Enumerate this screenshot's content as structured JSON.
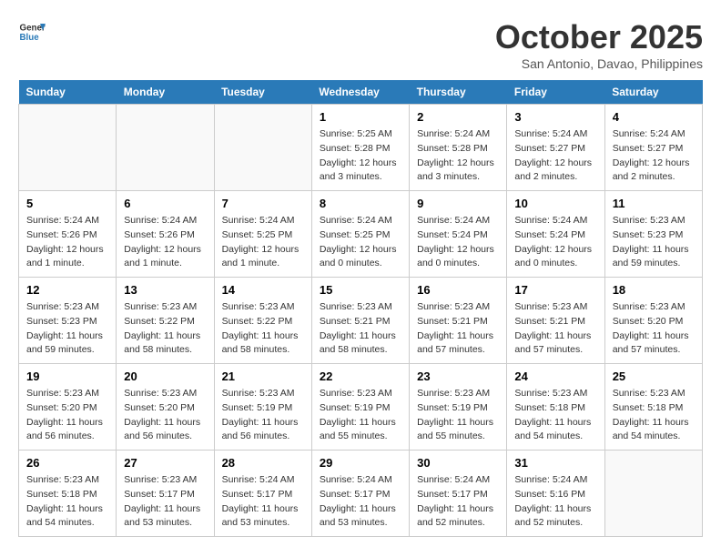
{
  "logo": {
    "line1": "General",
    "line2": "Blue"
  },
  "title": "October 2025",
  "subtitle": "San Antonio, Davao, Philippines",
  "days_of_week": [
    "Sunday",
    "Monday",
    "Tuesday",
    "Wednesday",
    "Thursday",
    "Friday",
    "Saturday"
  ],
  "weeks": [
    [
      {
        "day": "",
        "info": ""
      },
      {
        "day": "",
        "info": ""
      },
      {
        "day": "",
        "info": ""
      },
      {
        "day": "1",
        "info": "Sunrise: 5:25 AM\nSunset: 5:28 PM\nDaylight: 12 hours and 3 minutes."
      },
      {
        "day": "2",
        "info": "Sunrise: 5:24 AM\nSunset: 5:28 PM\nDaylight: 12 hours and 3 minutes."
      },
      {
        "day": "3",
        "info": "Sunrise: 5:24 AM\nSunset: 5:27 PM\nDaylight: 12 hours and 2 minutes."
      },
      {
        "day": "4",
        "info": "Sunrise: 5:24 AM\nSunset: 5:27 PM\nDaylight: 12 hours and 2 minutes."
      }
    ],
    [
      {
        "day": "5",
        "info": "Sunrise: 5:24 AM\nSunset: 5:26 PM\nDaylight: 12 hours and 1 minute."
      },
      {
        "day": "6",
        "info": "Sunrise: 5:24 AM\nSunset: 5:26 PM\nDaylight: 12 hours and 1 minute."
      },
      {
        "day": "7",
        "info": "Sunrise: 5:24 AM\nSunset: 5:25 PM\nDaylight: 12 hours and 1 minute."
      },
      {
        "day": "8",
        "info": "Sunrise: 5:24 AM\nSunset: 5:25 PM\nDaylight: 12 hours and 0 minutes."
      },
      {
        "day": "9",
        "info": "Sunrise: 5:24 AM\nSunset: 5:24 PM\nDaylight: 12 hours and 0 minutes."
      },
      {
        "day": "10",
        "info": "Sunrise: 5:24 AM\nSunset: 5:24 PM\nDaylight: 12 hours and 0 minutes."
      },
      {
        "day": "11",
        "info": "Sunrise: 5:23 AM\nSunset: 5:23 PM\nDaylight: 11 hours and 59 minutes."
      }
    ],
    [
      {
        "day": "12",
        "info": "Sunrise: 5:23 AM\nSunset: 5:23 PM\nDaylight: 11 hours and 59 minutes."
      },
      {
        "day": "13",
        "info": "Sunrise: 5:23 AM\nSunset: 5:22 PM\nDaylight: 11 hours and 58 minutes."
      },
      {
        "day": "14",
        "info": "Sunrise: 5:23 AM\nSunset: 5:22 PM\nDaylight: 11 hours and 58 minutes."
      },
      {
        "day": "15",
        "info": "Sunrise: 5:23 AM\nSunset: 5:21 PM\nDaylight: 11 hours and 58 minutes."
      },
      {
        "day": "16",
        "info": "Sunrise: 5:23 AM\nSunset: 5:21 PM\nDaylight: 11 hours and 57 minutes."
      },
      {
        "day": "17",
        "info": "Sunrise: 5:23 AM\nSunset: 5:21 PM\nDaylight: 11 hours and 57 minutes."
      },
      {
        "day": "18",
        "info": "Sunrise: 5:23 AM\nSunset: 5:20 PM\nDaylight: 11 hours and 57 minutes."
      }
    ],
    [
      {
        "day": "19",
        "info": "Sunrise: 5:23 AM\nSunset: 5:20 PM\nDaylight: 11 hours and 56 minutes."
      },
      {
        "day": "20",
        "info": "Sunrise: 5:23 AM\nSunset: 5:20 PM\nDaylight: 11 hours and 56 minutes."
      },
      {
        "day": "21",
        "info": "Sunrise: 5:23 AM\nSunset: 5:19 PM\nDaylight: 11 hours and 56 minutes."
      },
      {
        "day": "22",
        "info": "Sunrise: 5:23 AM\nSunset: 5:19 PM\nDaylight: 11 hours and 55 minutes."
      },
      {
        "day": "23",
        "info": "Sunrise: 5:23 AM\nSunset: 5:19 PM\nDaylight: 11 hours and 55 minutes."
      },
      {
        "day": "24",
        "info": "Sunrise: 5:23 AM\nSunset: 5:18 PM\nDaylight: 11 hours and 54 minutes."
      },
      {
        "day": "25",
        "info": "Sunrise: 5:23 AM\nSunset: 5:18 PM\nDaylight: 11 hours and 54 minutes."
      }
    ],
    [
      {
        "day": "26",
        "info": "Sunrise: 5:23 AM\nSunset: 5:18 PM\nDaylight: 11 hours and 54 minutes."
      },
      {
        "day": "27",
        "info": "Sunrise: 5:23 AM\nSunset: 5:17 PM\nDaylight: 11 hours and 53 minutes."
      },
      {
        "day": "28",
        "info": "Sunrise: 5:24 AM\nSunset: 5:17 PM\nDaylight: 11 hours and 53 minutes."
      },
      {
        "day": "29",
        "info": "Sunrise: 5:24 AM\nSunset: 5:17 PM\nDaylight: 11 hours and 53 minutes."
      },
      {
        "day": "30",
        "info": "Sunrise: 5:24 AM\nSunset: 5:17 PM\nDaylight: 11 hours and 52 minutes."
      },
      {
        "day": "31",
        "info": "Sunrise: 5:24 AM\nSunset: 5:16 PM\nDaylight: 11 hours and 52 minutes."
      },
      {
        "day": "",
        "info": ""
      }
    ]
  ]
}
